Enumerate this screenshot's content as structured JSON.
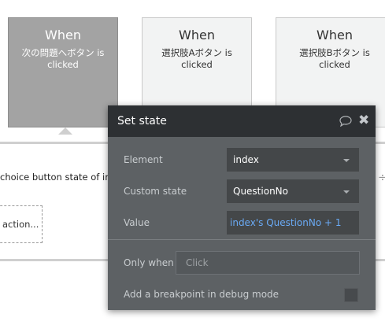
{
  "events": [
    {
      "when": "When",
      "desc_line1": "次の問題へボタン is",
      "desc_line2": "clicked"
    },
    {
      "when": "When",
      "desc_line1": "選択肢Aボタン is",
      "desc_line2": "clicked"
    },
    {
      "when": "When",
      "desc_line1": "選択肢Bボタン is",
      "desc_line2": "clicked"
    }
  ],
  "action": {
    "text": "choice button state of inc",
    "add_action_label": "action..."
  },
  "popup": {
    "title": "Set state",
    "comment_icon": "speech-bubble-icon",
    "close_icon": "✖",
    "element_label": "Element",
    "element_value": "index",
    "custom_state_label": "Custom state",
    "custom_state_value": "QuestionNo",
    "value_label": "Value",
    "value_expression": "index's QuestionNo + 1",
    "only_when_label": "Only when",
    "only_when_placeholder": "Click",
    "breakpoint_label": "Add a breakpoint in debug mode",
    "breakpoint_checked": false
  },
  "colors": {
    "popup_header": "#2d3033",
    "popup_body": "#5d6164",
    "expression_blue": "#6aaaf5",
    "selected_card": "#a3a3a3"
  }
}
